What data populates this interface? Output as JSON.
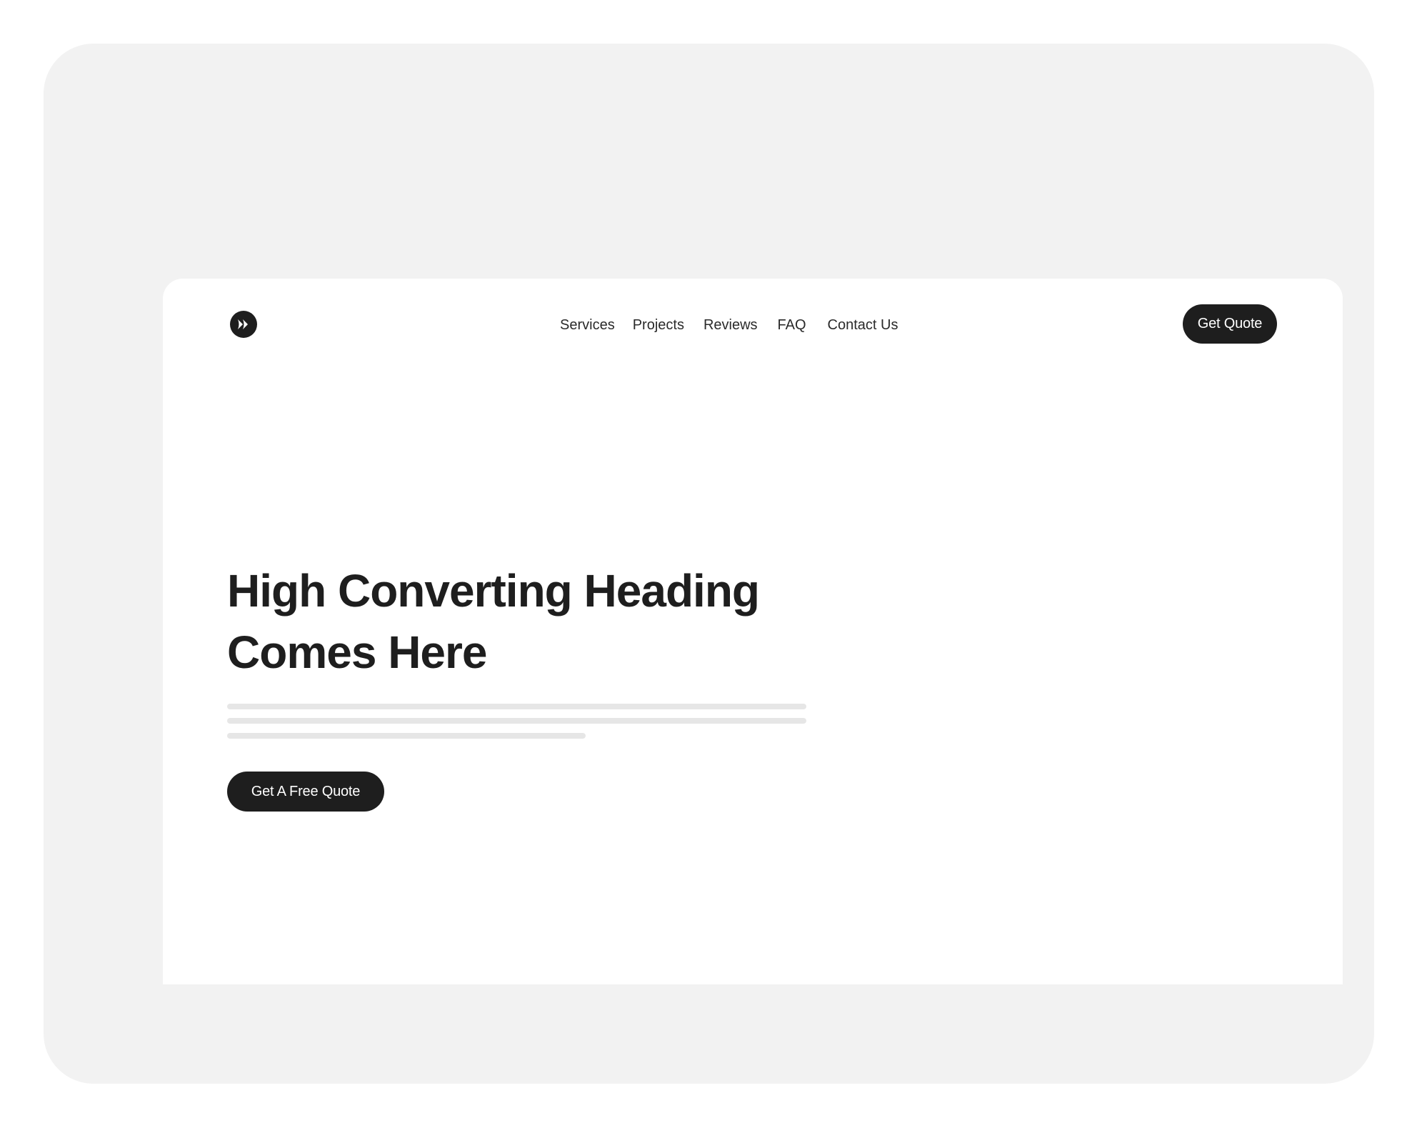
{
  "nav": {
    "logo_icon": "double-chevron-right-icon",
    "links": [
      "Services",
      "Projects",
      "Reviews",
      "FAQ",
      "Contact Us"
    ],
    "cta_label": "Get Quote"
  },
  "hero": {
    "title_line1": "High Converting Heading",
    "title_line2": "Comes Here",
    "cta_label": "Get A Free Quote"
  },
  "colors": {
    "outer_background": "#f2f2f2",
    "card_background": "#ffffff",
    "primary_dark": "#1e1e1e",
    "placeholder_line": "#e6e6e6"
  }
}
